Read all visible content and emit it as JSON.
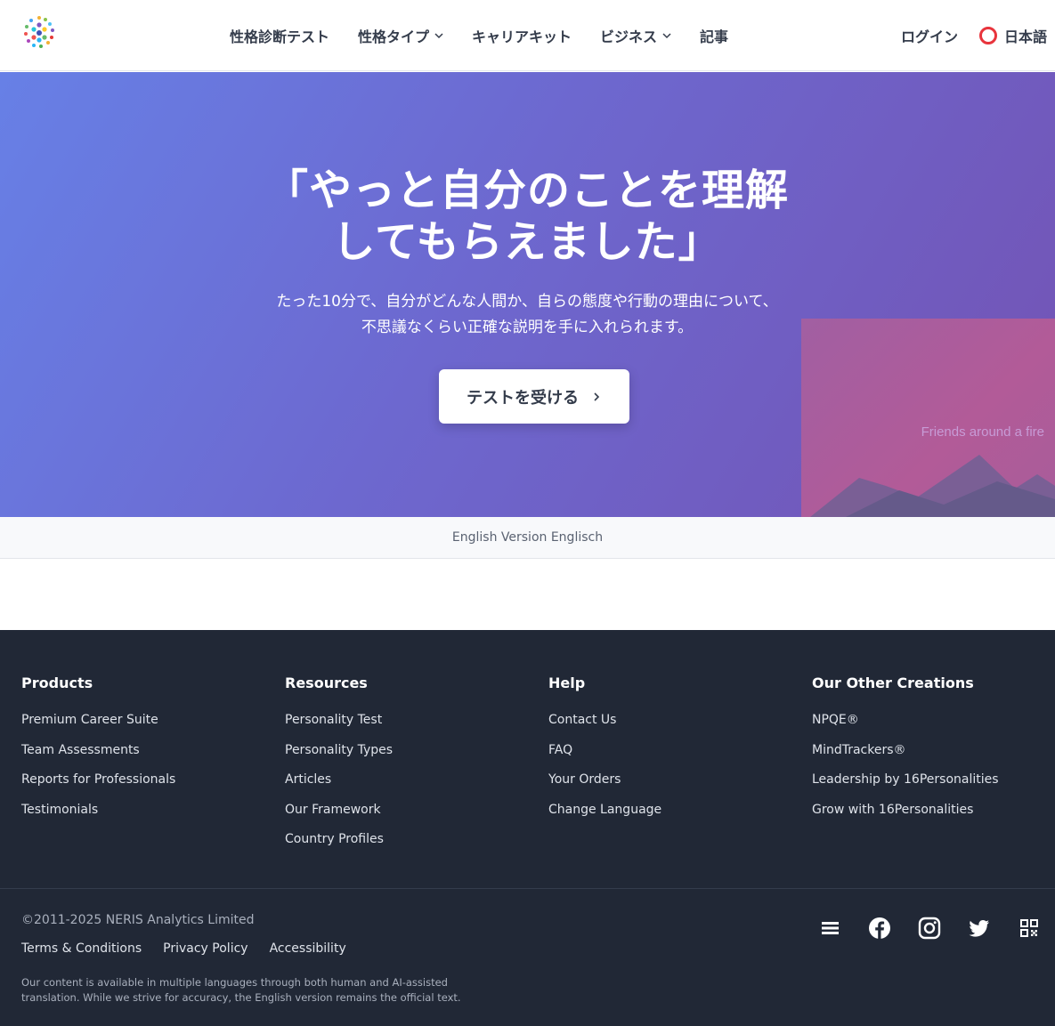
{
  "header": {
    "logo_icon": "16personalities-dots-logo",
    "nav": [
      {
        "label": "性格診断テスト",
        "dropdown": false
      },
      {
        "label": "性格タイプ",
        "dropdown": true
      },
      {
        "label": "キャリアキット",
        "dropdown": false
      },
      {
        "label": "ビジネス",
        "dropdown": true
      },
      {
        "label": "記事",
        "dropdown": false
      }
    ],
    "login": "ログイン",
    "language": "日本語"
  },
  "hero": {
    "title_line1": "「やっと自分のことを理解",
    "title_line2": "してもらえました」",
    "subtitle_line1": "たった10分で、自分がどんな人間か、自らの態度や行動の理由について、",
    "subtitle_line2": "不思議なくらい正確な説明を手に入れられます。",
    "cta": "テストを受ける",
    "image_alt": "Friends around a fire"
  },
  "english_bar": "English Version Englisch",
  "footer": {
    "columns": [
      {
        "title": "Products",
        "links": [
          "Premium Career Suite",
          "Team Assessments",
          "Reports for Professionals",
          "Testimonials"
        ]
      },
      {
        "title": "Resources",
        "links": [
          "Personality Test",
          "Personality Types",
          "Articles",
          "Our Framework",
          "Country Profiles"
        ]
      },
      {
        "title": "Help",
        "links": [
          "Contact Us",
          "FAQ",
          "Your Orders",
          "Change Language"
        ]
      },
      {
        "title": "Our Other Creations",
        "links": [
          "NPQE®",
          "MindTrackers®",
          "Leadership by 16Personalities",
          "Grow with 16Personalities"
        ]
      }
    ],
    "copyright": "©2011-2025 NERIS Analytics Limited",
    "legal": [
      "Terms & Conditions",
      "Privacy Policy",
      "Accessibility"
    ],
    "note_line1": "Our content is available in multiple languages through both human and AI-assisted",
    "note_line2": "translation. While we strive for accuracy, the English version remains the official text.",
    "social": [
      "menu-icon",
      "facebook-icon",
      "instagram-icon",
      "twitter-icon",
      "qr-code-icon"
    ]
  },
  "colors": {
    "hero_gradient_start": "#6780e6",
    "hero_gradient_end": "#7353b4",
    "footer_bg": "#212836",
    "text_dark": "#343c4b",
    "language_ring": "#e8343c"
  }
}
